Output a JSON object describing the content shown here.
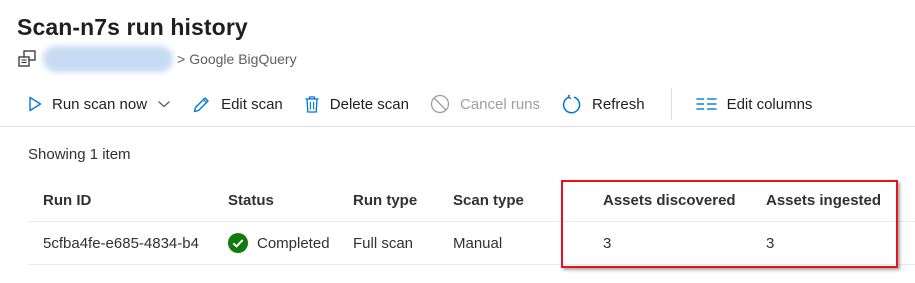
{
  "header": {
    "title": "Scan-n7s run history",
    "breadcrumb_separator": ">",
    "breadcrumb_source": "Google BigQuery"
  },
  "toolbar": {
    "run_scan_now": "Run scan now",
    "edit_scan": "Edit scan",
    "delete_scan": "Delete scan",
    "cancel_runs": "Cancel runs",
    "refresh": "Refresh",
    "edit_columns": "Edit columns"
  },
  "list": {
    "showing_text": "Showing 1 item",
    "columns": {
      "run_id": "Run ID",
      "status": "Status",
      "run_type": "Run type",
      "scan_type": "Scan type",
      "assets_discovered": "Assets discovered",
      "assets_ingested": "Assets ingested"
    },
    "rows": [
      {
        "run_id": "5cfba4fe-e685-4834-b4",
        "status": "Completed",
        "run_type": "Full scan",
        "scan_type": "Manual",
        "assets_discovered": "3",
        "assets_ingested": "3"
      }
    ]
  },
  "colors": {
    "accent": "#0078d4",
    "success": "#107c10",
    "highlight_border": "#e81123",
    "disabled": "#a19f9d"
  },
  "icons": {
    "resource": "resource-icon",
    "run": "play-icon",
    "dropdown": "chevron-down-icon",
    "edit": "pencil-icon",
    "delete": "trash-icon",
    "cancel": "cancel-icon",
    "refresh": "refresh-icon",
    "columns": "columns-icon",
    "status_ok": "check-circle-icon"
  }
}
